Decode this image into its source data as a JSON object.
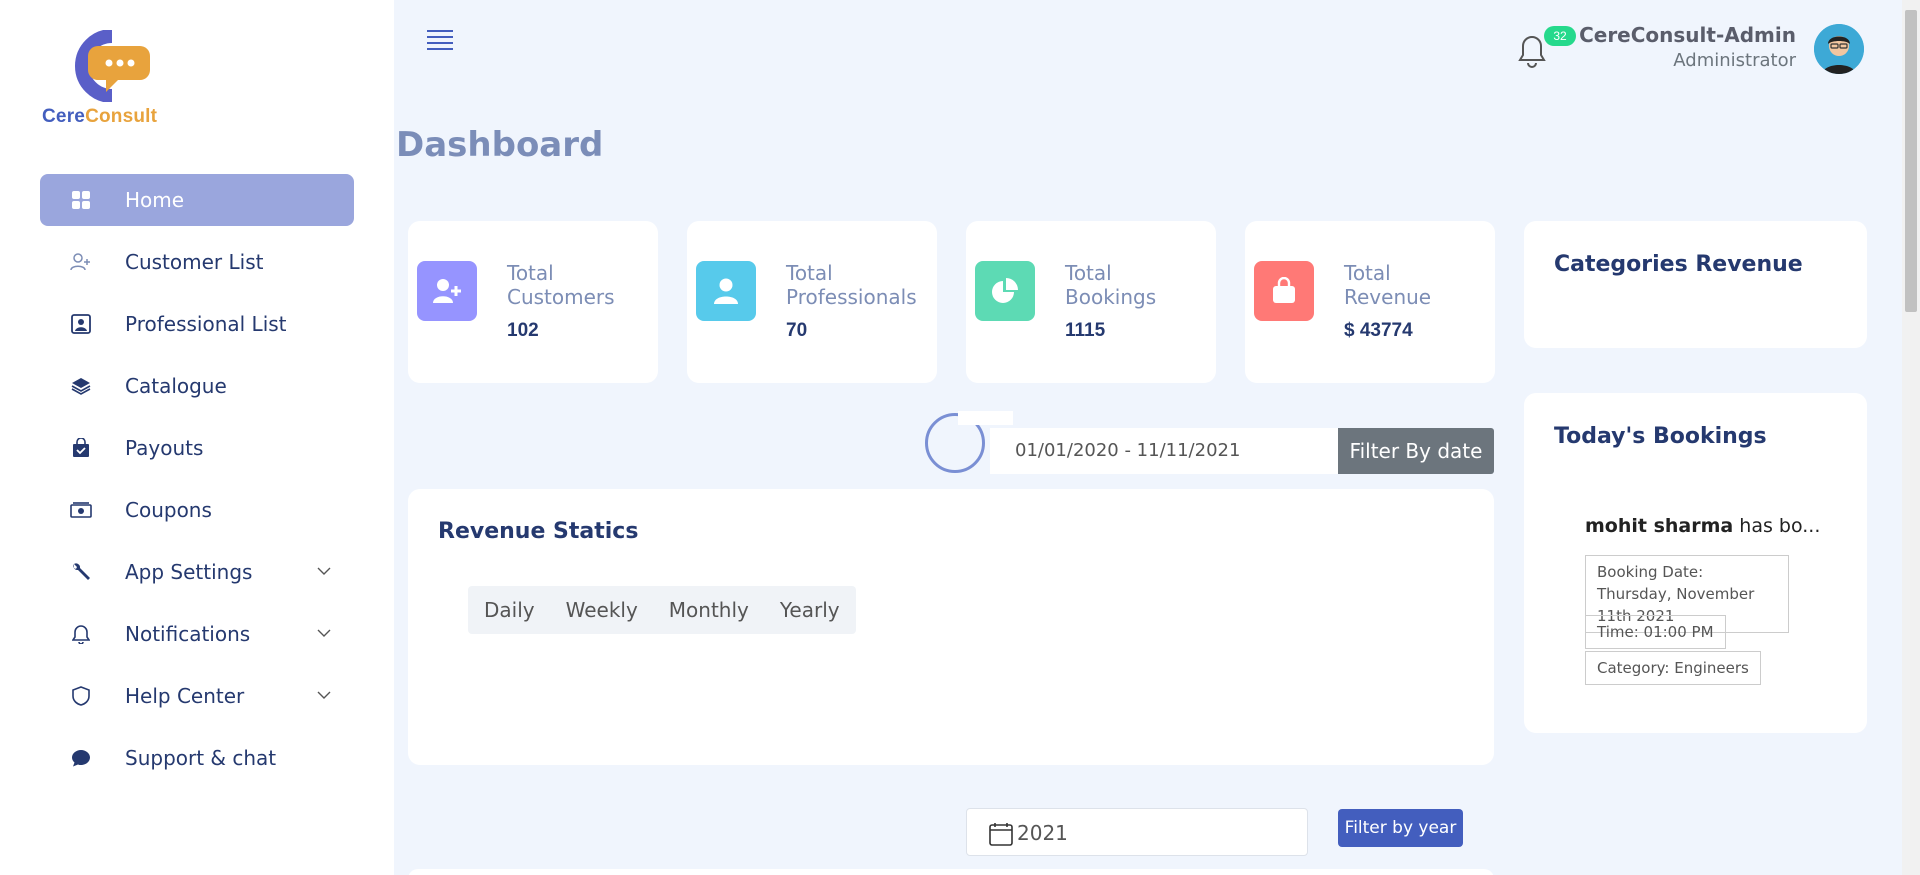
{
  "brand": {
    "name_part1": "Cere",
    "name_part2": "Consult"
  },
  "sidebar": {
    "items": [
      {
        "label": "Home",
        "icon": "grid-icon",
        "active": true
      },
      {
        "label": "Customer List",
        "icon": "user-plus-icon"
      },
      {
        "label": "Professional List",
        "icon": "person-badge-icon"
      },
      {
        "label": "Catalogue",
        "icon": "stack-icon"
      },
      {
        "label": "Payouts",
        "icon": "bag-check-icon"
      },
      {
        "label": "Coupons",
        "icon": "cash-icon"
      },
      {
        "label": "App Settings",
        "icon": "wrench-icon",
        "expandable": true
      },
      {
        "label": "Notifications",
        "icon": "bell-icon",
        "expandable": true
      },
      {
        "label": "Help Center",
        "icon": "shield-icon",
        "expandable": true
      },
      {
        "label": "Support & chat",
        "icon": "chat-icon"
      }
    ]
  },
  "header": {
    "notification_count": "32",
    "user_name": "CereConsult-Admin",
    "user_role": "Administrator"
  },
  "page": {
    "title": "Dashboard"
  },
  "stats": [
    {
      "label": "Total Customers",
      "value": "102",
      "color": "#9694ff"
    },
    {
      "label": "Total Professionals",
      "value": "70",
      "color": "#57caeb"
    },
    {
      "label": "Total Bookings",
      "value": "1115",
      "color": "#5ddab4"
    },
    {
      "label": "Total Revenue",
      "value": "$ 43774",
      "color": "#ff7976"
    }
  ],
  "date_filter": {
    "range": "01/01/2020 - 11/11/2021",
    "button": "Filter By date"
  },
  "revenue": {
    "title": "Revenue Statics",
    "tabs": [
      "Daily",
      "Weekly",
      "Monthly",
      "Yearly"
    ]
  },
  "year_filter": {
    "value": "2021",
    "button": "Filter by year"
  },
  "categories_revenue": {
    "title": "Categories Revenue"
  },
  "todays_bookings": {
    "title": "Today's Bookings",
    "entry": {
      "name": "mohit sharma",
      "text": " has bo...",
      "booking_date": "Booking Date: Thursday, November 11th 2021",
      "time": "Time: 01:00 PM",
      "category": "Category: Engineers"
    }
  }
}
